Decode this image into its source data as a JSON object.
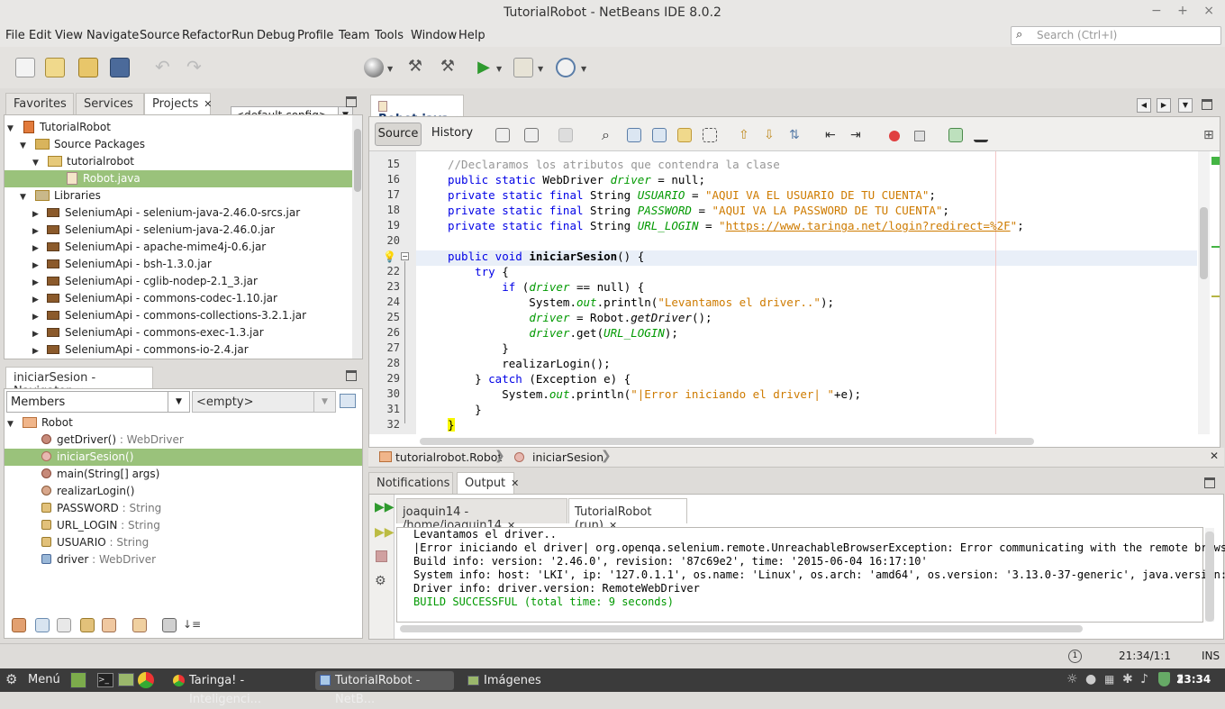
{
  "window": {
    "title": "TutorialRobot - NetBeans IDE 8.0.2",
    "controls": [
      "−",
      "+",
      "×"
    ]
  },
  "menu": [
    "File",
    "Edit",
    "View",
    "Navigate",
    "Source",
    "Refactor",
    "Run",
    "Debug",
    "Profile",
    "Team",
    "Tools",
    "Window",
    "Help"
  ],
  "search": {
    "placeholder": "Search (Ctrl+I)"
  },
  "toolbar": {
    "config": "<default config>"
  },
  "project_tabs": [
    "Favorites",
    "Services",
    "Projects"
  ],
  "project_tree": [
    {
      "label": "TutorialRobot",
      "icon": "project-icon",
      "toggle": "▼"
    },
    {
      "label": "Source Packages",
      "icon": "source-packages-icon",
      "toggle": "▼"
    },
    {
      "label": "tutorialrobot",
      "icon": "package-icon",
      "toggle": "▼"
    },
    {
      "label": "Robot.java",
      "icon": "java-file-icon",
      "toggle": ""
    },
    {
      "label": "Libraries",
      "icon": "libraries-icon",
      "toggle": "▼"
    },
    {
      "label": "SeleniumApi - selenium-java-2.46.0-srcs.jar",
      "icon": "jar-icon",
      "toggle": "▶"
    },
    {
      "label": "SeleniumApi - selenium-java-2.46.0.jar",
      "icon": "jar-icon",
      "toggle": "▶"
    },
    {
      "label": "SeleniumApi - apache-mime4j-0.6.jar",
      "icon": "jar-icon",
      "toggle": "▶"
    },
    {
      "label": "SeleniumApi - bsh-1.3.0.jar",
      "icon": "jar-icon",
      "toggle": "▶"
    },
    {
      "label": "SeleniumApi - cglib-nodep-2.1_3.jar",
      "icon": "jar-icon",
      "toggle": "▶"
    },
    {
      "label": "SeleniumApi - commons-codec-1.10.jar",
      "icon": "jar-icon",
      "toggle": "▶"
    },
    {
      "label": "SeleniumApi - commons-collections-3.2.1.jar",
      "icon": "jar-icon",
      "toggle": "▶"
    },
    {
      "label": "SeleniumApi - commons-exec-1.3.jar",
      "icon": "jar-icon",
      "toggle": "▶"
    },
    {
      "label": "SeleniumApi - commons-io-2.4.jar",
      "icon": "jar-icon",
      "toggle": "▶"
    }
  ],
  "navigator": {
    "tab": "iniciarSesion - Navigator",
    "filter": "Members",
    "filter2": "<empty>",
    "root": "Robot",
    "members": [
      {
        "name": "getDriver()",
        "type": " : WebDriver"
      },
      {
        "name": "iniciarSesion()",
        "type": ""
      },
      {
        "name": "main(String[] args)",
        "type": ""
      },
      {
        "name": "realizarLogin()",
        "type": ""
      },
      {
        "name": "PASSWORD",
        "type": " : String"
      },
      {
        "name": "URL_LOGIN",
        "type": " : String"
      },
      {
        "name": "USUARIO",
        "type": " : String"
      },
      {
        "name": "driver",
        "type": " : WebDriver"
      }
    ]
  },
  "editor": {
    "tab": "Robot.java",
    "modes": [
      "Source",
      "History"
    ],
    "breadcrumb": [
      "tutorialrobot.Robot",
      "iniciarSesion"
    ],
    "line_numbers": [
      "15",
      "16",
      "17",
      "18",
      "19",
      "20",
      "21",
      "22",
      "23",
      "24",
      "25",
      "26",
      "27",
      "28",
      "29",
      "30",
      "31",
      "32"
    ],
    "code": {
      "l15": "//Declaramos los atributos que contendra la clase",
      "l16a": "public static ",
      "l16b": "WebDriver ",
      "l16c": "driver",
      "l16d": " = null;",
      "l17a": "private static final ",
      "l17b": "String ",
      "l17c": "USUARIO",
      "l17d": " = ",
      "l17e": "\"AQUI VA EL USUARIO DE TU CUENTA\"",
      "l17f": ";",
      "l18a": "private static final ",
      "l18b": "String ",
      "l18c": "PASSWORD",
      "l18d": " = ",
      "l18e": "\"AQUI VA LA PASSWORD DE TU CUENTA\"",
      "l18f": ";",
      "l19a": "private static final ",
      "l19b": "String ",
      "l19c": "URL_LOGIN",
      "l19d": " = ",
      "l19e": "\"",
      "l19f": "https://www.taringa.net/login?redirect=%2F",
      "l19g": "\"",
      "l19h": ";",
      "l21a": "public void ",
      "l21b": "iniciarSesion",
      "l21c": "() {",
      "l22a": "    try",
      "l22b": " {",
      "l23a": "        if",
      "l23b": " (",
      "l23c": "driver",
      "l23d": " == null) {",
      "l24a": "            System.",
      "l24b": "out",
      "l24c": ".println(",
      "l24d": "\"Levantamos el driver..\"",
      "l24e": ");",
      "l25a": "            ",
      "l25b": "driver",
      "l25c": " = Robot.",
      "l25d": "getDriver",
      "l25e": "();",
      "l26a": "            ",
      "l26b": "driver",
      "l26c": ".get(",
      "l26d": "URL_LOGIN",
      "l26e": ");",
      "l27": "        }",
      "l28": "        realizarLogin();",
      "l29a": "    } ",
      "l29b": "catch",
      "l29c": " (Exception e) {",
      "l30a": "        System.",
      "l30b": "out",
      "l30c": ".println(",
      "l30d": "\"|Error iniciando el driver| \"",
      "l30e": "+e);",
      "l31": "    }",
      "l32": "}"
    }
  },
  "bottom_tabs": [
    "Notifications",
    "Output"
  ],
  "output_tabs": [
    "joaquin14 - /home/joaquin14",
    "TutorialRobot (run)"
  ],
  "output_lines": [
    "Levantamos el driver..",
    "|Error iniciando el driver| org.openqa.selenium.remote.UnreachableBrowserException: Error communicating with the remote brows",
    "Build info: version: '2.46.0', revision: '87c69e2', time: '2015-06-04 16:17:10'",
    "System info: host: 'LKI', ip: '127.0.1.1', os.name: 'Linux', os.arch: 'amd64', os.version: '3.13.0-37-generic', java.version:",
    "Driver info: driver.version: RemoteWebDriver",
    "BUILD SUCCESSFUL (total time: 9 seconds)"
  ],
  "status": {
    "position": "21:34/1:1",
    "mode": "INS",
    "notifications": "1"
  },
  "taskbar": {
    "menu": "Menú",
    "tasks": [
      "Taringa! - Inteligenci...",
      "TutorialRobot - NetB...",
      "Imágenes"
    ],
    "clock": "23:34"
  },
  "colors": {
    "selection": "#9ac27b",
    "keyword": "#0000e6",
    "string": "#ce7b00",
    "comment": "#969696",
    "field": "#009900",
    "build_success": "#009900"
  }
}
